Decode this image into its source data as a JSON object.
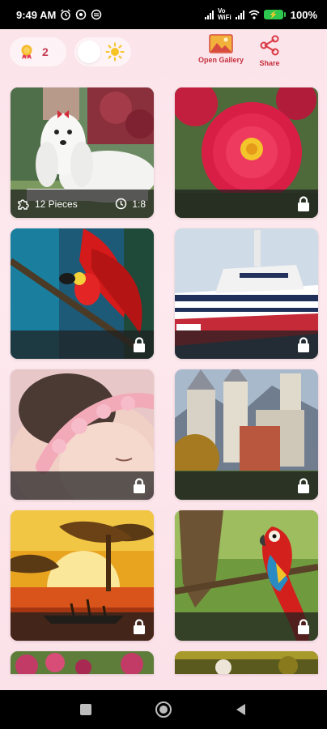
{
  "status_bar": {
    "time": "9:49 AM",
    "volte_label": "Vo\nWiFi",
    "battery_label": "",
    "battery_percent": "100%"
  },
  "header": {
    "badge_count": "2",
    "open_gallery_label": "Open Gallery",
    "share_label": "Share",
    "accent_color": "#c62f3d"
  },
  "puzzles": [
    {
      "subject": "maltese dog",
      "unlocked": true,
      "pieces_label": "12 Pieces",
      "time_label": "1:8"
    },
    {
      "subject": "red dahlia flower",
      "unlocked": false
    },
    {
      "subject": "bird of paradise",
      "unlocked": false
    },
    {
      "subject": "cruise ship",
      "unlocked": false
    },
    {
      "subject": "sleeping baby",
      "unlocked": false
    },
    {
      "subject": "castle",
      "unlocked": false
    },
    {
      "subject": "african sunset",
      "unlocked": false
    },
    {
      "subject": "scarlet macaw",
      "unlocked": false
    },
    {
      "subject": "flowers",
      "unlocked": false
    },
    {
      "subject": "garden",
      "unlocked": false
    }
  ]
}
